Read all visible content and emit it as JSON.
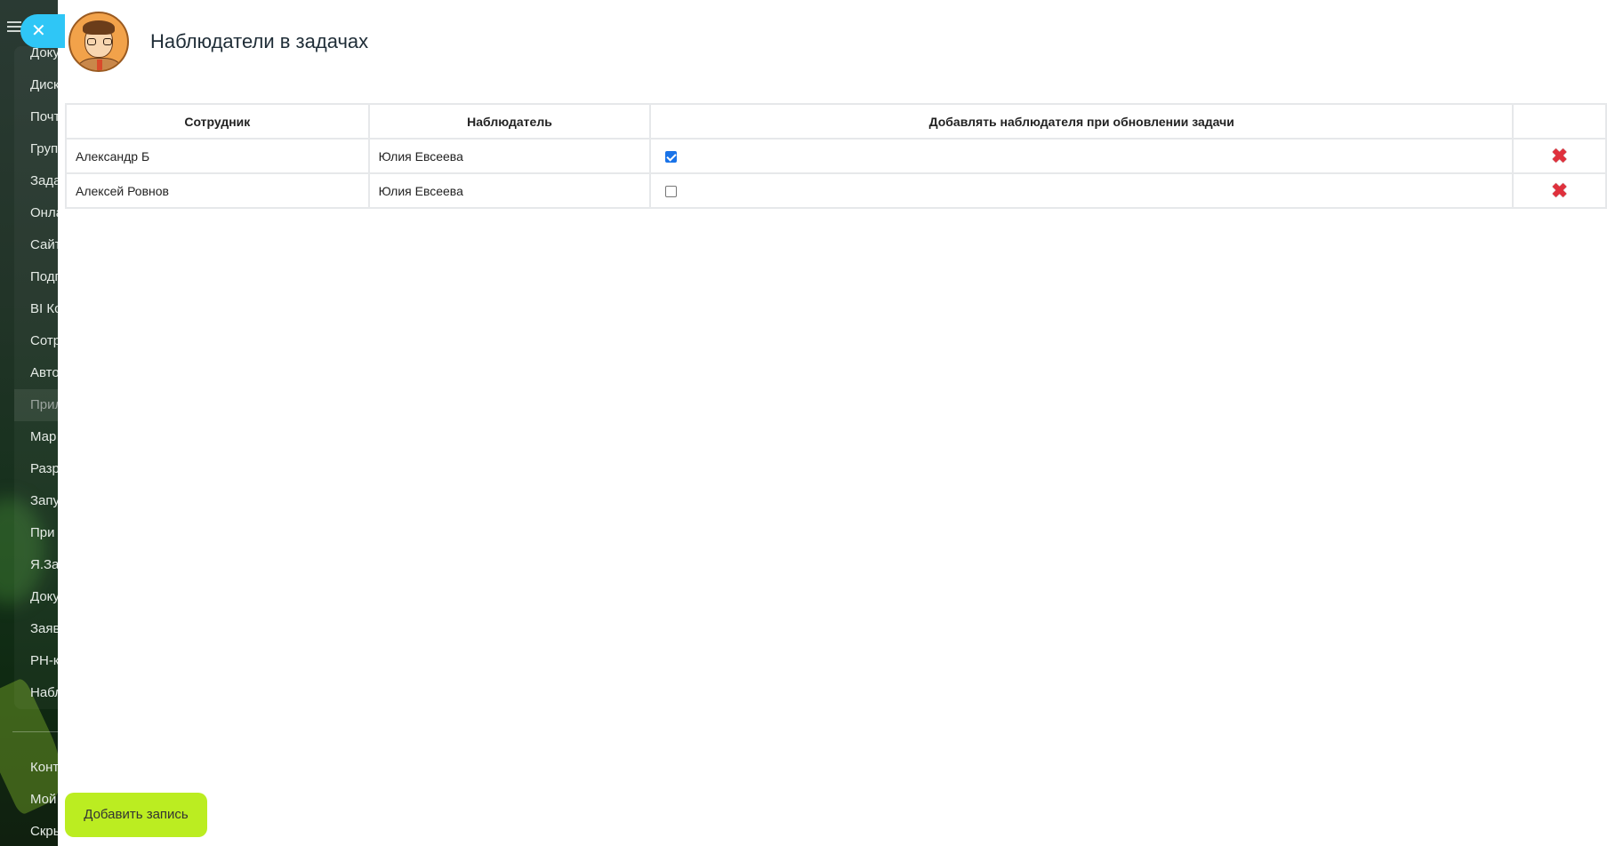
{
  "sidebar": {
    "items": [
      {
        "label": "Доку"
      },
      {
        "label": "Диск"
      },
      {
        "label": "Почт"
      },
      {
        "label": "Груп"
      },
      {
        "label": "Зада"
      },
      {
        "label": "Онла"
      },
      {
        "label": "Сайт"
      },
      {
        "label": "Подп"
      },
      {
        "label": "BI Ко"
      },
      {
        "label": "Сотр"
      },
      {
        "label": "Авто"
      },
      {
        "label": "Прил"
      },
      {
        "label": "Мар"
      },
      {
        "label": "Разр"
      },
      {
        "label": "Запу"
      },
      {
        "label": "При"
      },
      {
        "label": "Я.Зап"
      },
      {
        "label": "Доку"
      },
      {
        "label": "Заяв"
      },
      {
        "label": "PH-к"
      },
      {
        "label": "Набл"
      }
    ],
    "bottom_items": [
      {
        "label": "Конт"
      },
      {
        "label": "Мой"
      },
      {
        "label": "Скры"
      }
    ]
  },
  "close_button": {
    "icon": "close-icon",
    "glyph": "✕"
  },
  "header": {
    "title": "Наблюдатели в задачах",
    "avatar_icon": "avatar-icon"
  },
  "table": {
    "headers": [
      "Сотрудник",
      "Наблюдатель",
      "Добавлять наблюдателя при обновлении задачи",
      ""
    ],
    "rows": [
      {
        "employee": "Александр Б",
        "observer": "Юлия Евсеева",
        "add_on_update": true
      },
      {
        "employee": "Алексей Ровнов",
        "observer": "Юлия Евсеева",
        "add_on_update": false
      }
    ],
    "delete_glyph": "✖"
  },
  "add_button": {
    "label": "Добавить запись"
  },
  "colors": {
    "close_button": "#2fc6f6",
    "add_button": "#bbed21",
    "delete_icon": "#e0303c",
    "checkbox_checked": "#1a73e8"
  }
}
